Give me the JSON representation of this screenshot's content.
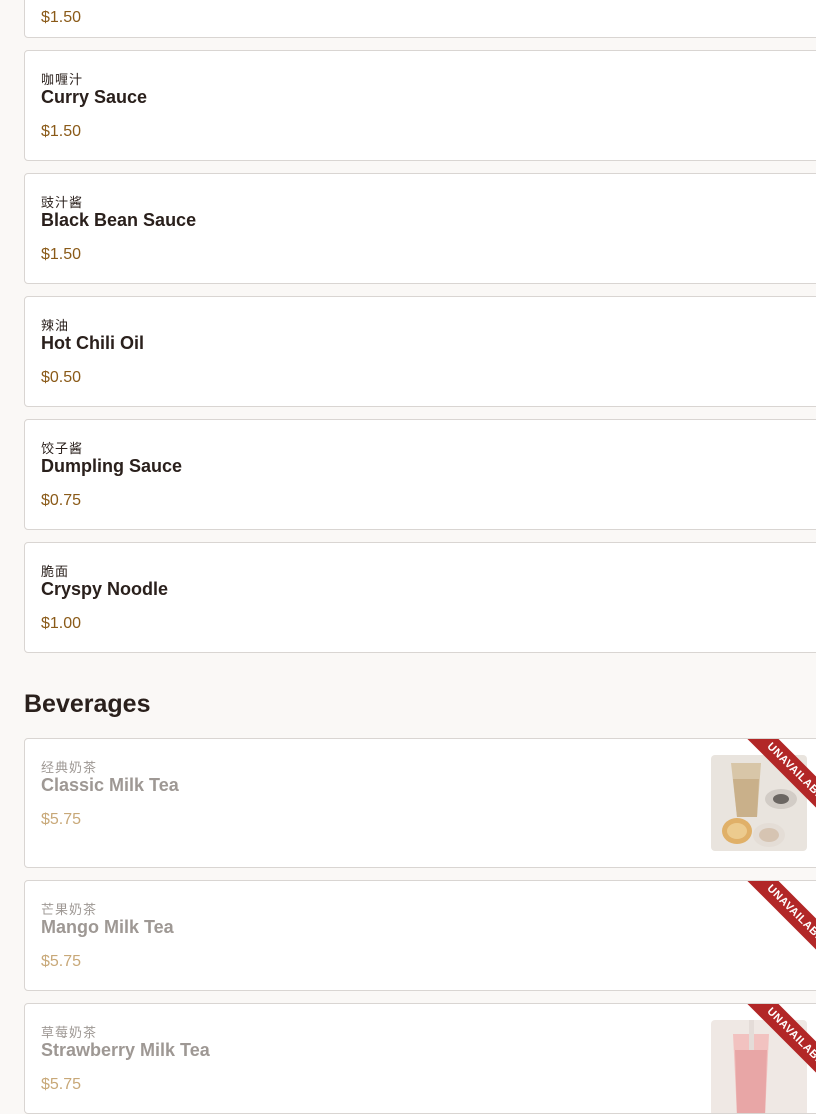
{
  "top_price": "$1.50",
  "addons": [
    {
      "cn": "咖喱汁",
      "en": "Curry Sauce",
      "price": "$1.50"
    },
    {
      "cn": "豉汁酱",
      "en": "Black Bean Sauce",
      "price": "$1.50"
    },
    {
      "cn": "辣油",
      "en": "Hot Chili Oil",
      "price": "$0.50"
    },
    {
      "cn": "饺子酱",
      "en": "Dumpling Sauce",
      "price": "$0.75"
    },
    {
      "cn": "脆面",
      "en": "Cryspy Noodle",
      "price": "$1.00"
    }
  ],
  "beverages": {
    "title": "Beverages",
    "items": [
      {
        "cn": "经典奶茶",
        "en": "Classic Milk Tea",
        "price": "$5.75",
        "badge": "UNAVAILABLE"
      },
      {
        "cn": "芒果奶茶",
        "en": "Mango Milk Tea",
        "price": "$5.75",
        "badge": "UNAVAILABLE"
      },
      {
        "cn": "草莓奶茶",
        "en": "Strawberry Milk Tea",
        "price": "$5.75",
        "badge": "UNAVAILABLE"
      }
    ]
  },
  "colors": {
    "price": "#8a5a18",
    "unavailable_ribbon": "#b22727",
    "card_border": "#d9d5d2",
    "background": "#faf8f6"
  }
}
